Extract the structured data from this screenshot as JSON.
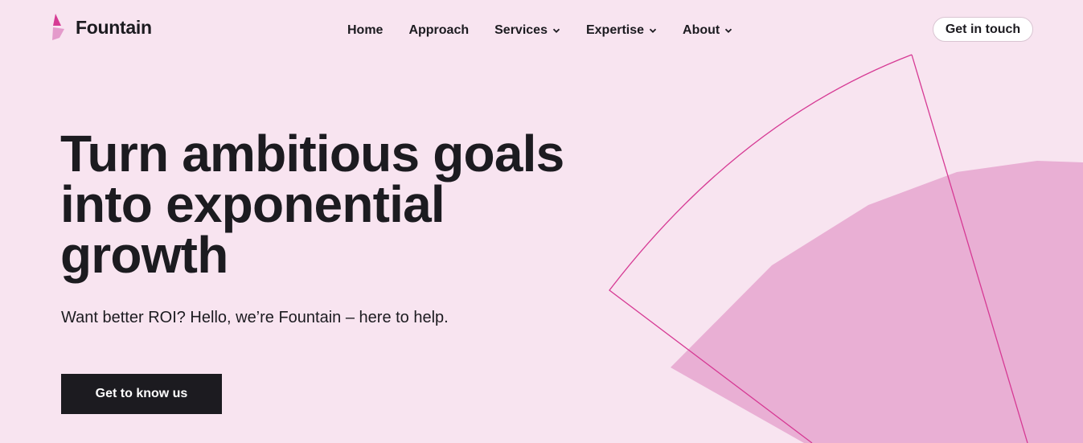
{
  "brand": {
    "name": "Fountain",
    "logo_icon": "fountain-logo-icon",
    "accent": "#d63a94",
    "accent_light": "#e9afd4"
  },
  "nav": {
    "items": [
      {
        "label": "Home",
        "has_dropdown": false
      },
      {
        "label": "Approach",
        "has_dropdown": false
      },
      {
        "label": "Services",
        "has_dropdown": true
      },
      {
        "label": "Expertise",
        "has_dropdown": true
      },
      {
        "label": "About",
        "has_dropdown": true
      }
    ],
    "dropdown_icon": "chevron-down-icon"
  },
  "header": {
    "cta_label": "Get in touch"
  },
  "hero": {
    "title": "Turn ambitious goals into exponential growth",
    "subtitle": "Want better ROI? Hello, we’re Fountain – here to help.",
    "button_label": "Get to know us"
  },
  "colors": {
    "background": "#f8e4f0",
    "text": "#1c1b20",
    "button_dark": "#1c1b20"
  }
}
